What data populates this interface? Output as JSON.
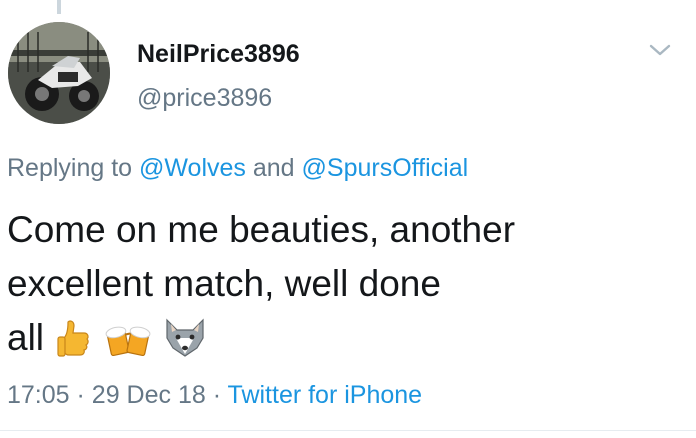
{
  "tweet": {
    "display_name": "NeilPrice3896",
    "handle": "@price3896",
    "replying_prefix": "Replying to",
    "reply_mention_1": "@Wolves",
    "reply_conjunction": "and",
    "reply_mention_2": "@SpursOfficial",
    "text_line_1": "Come on me beauties, another",
    "text_line_2": "excellent match, well done",
    "text_line_3": "all",
    "emojis": [
      "thumbs-up-icon",
      "clinking-beer-mugs-icon",
      "wolf-face-icon"
    ],
    "time": "17:05",
    "separator": "·",
    "date": "29 Dec 18",
    "source": "Twitter for iPhone"
  },
  "colors": {
    "text_primary": "#14171a",
    "text_secondary": "#657786",
    "link": "#1b95e0",
    "background": "#ffffff"
  }
}
